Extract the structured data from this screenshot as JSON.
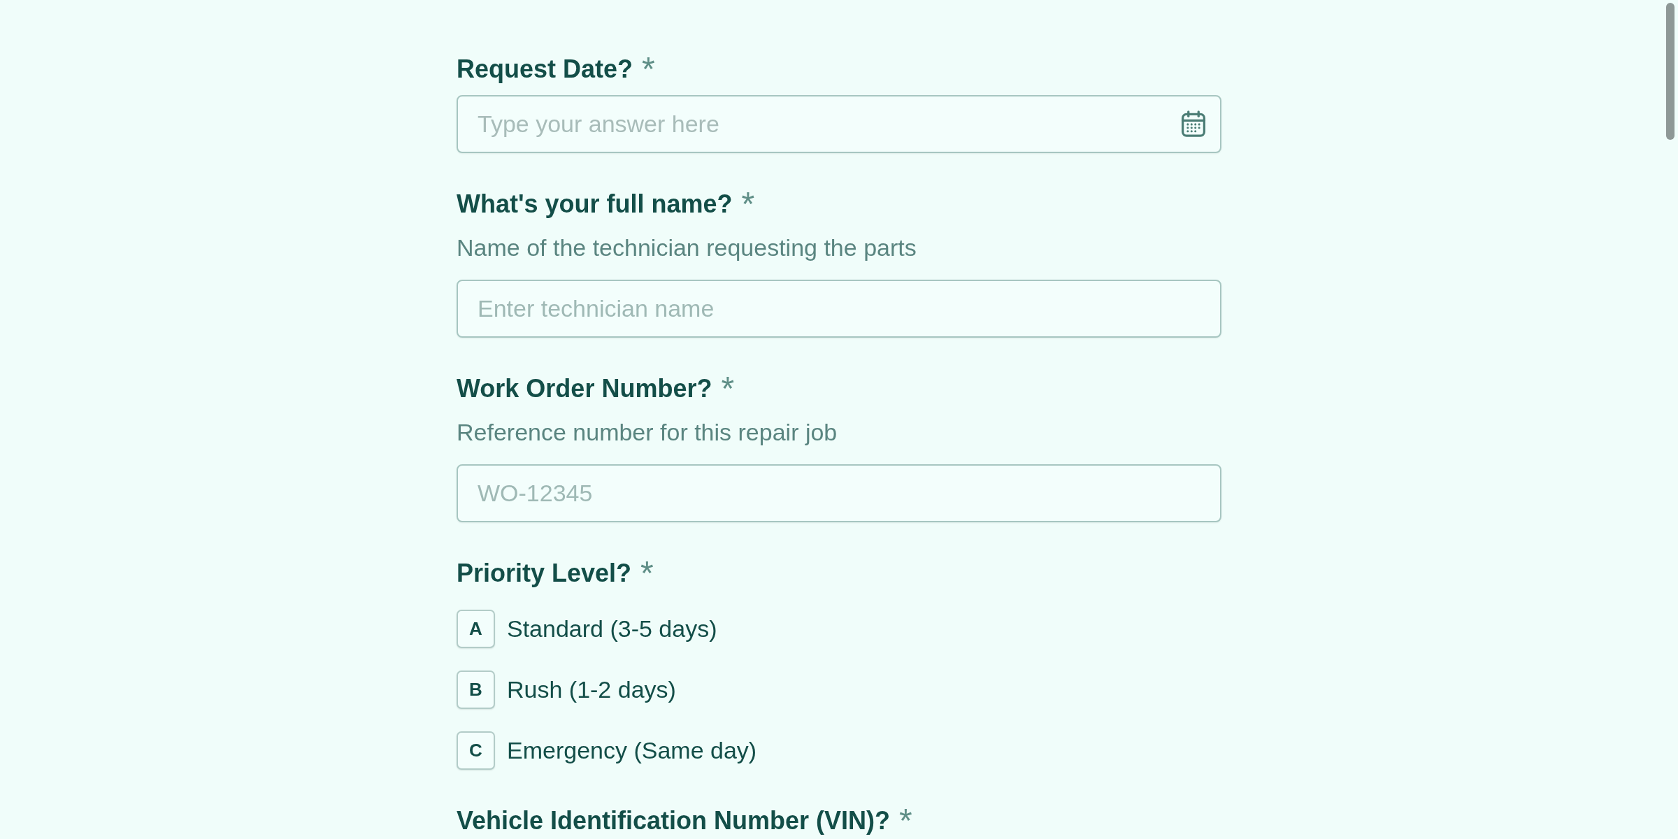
{
  "questions": [
    {
      "kind": "date",
      "label": "Request Date?",
      "required_mark": "*",
      "placeholder": "Type your answer here"
    },
    {
      "kind": "text",
      "label": "What's your full name?",
      "required_mark": "*",
      "description": "Name of the technician requesting the parts",
      "placeholder": "Enter technician name"
    },
    {
      "kind": "text",
      "label": "Work Order Number?",
      "required_mark": "*",
      "description": "Reference number for this repair job",
      "placeholder": "WO-12345"
    },
    {
      "kind": "choice",
      "label": "Priority Level?",
      "required_mark": "*",
      "options": [
        {
          "key": "A",
          "label": "Standard (3-5 days)",
          "selected": false
        },
        {
          "key": "B",
          "label": "Rush (1-2 days)",
          "selected": false
        },
        {
          "key": "C",
          "label": "Emergency (Same day)",
          "selected": false
        }
      ]
    },
    {
      "label": "Vehicle Identification Number (VIN)?",
      "required_mark": "*"
    }
  ]
}
